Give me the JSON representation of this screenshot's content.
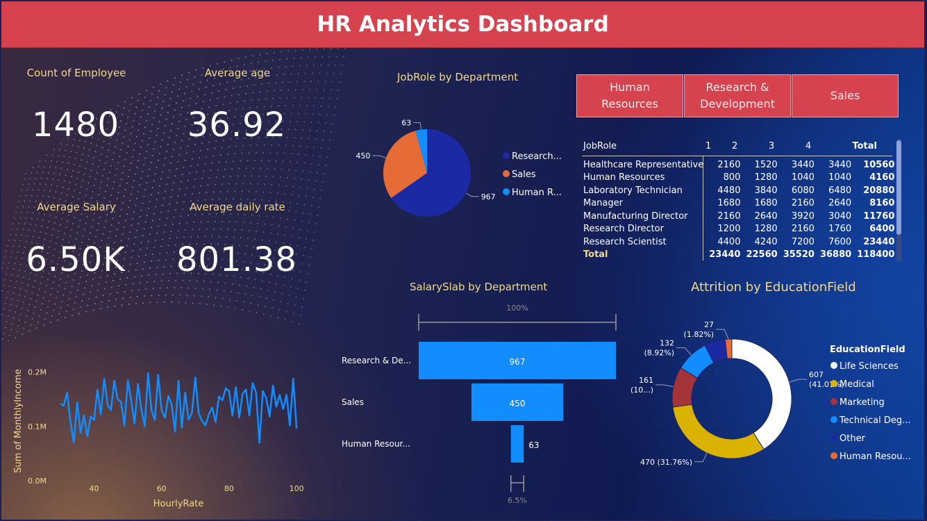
{
  "header": {
    "title": "HR Analytics Dashboard"
  },
  "kpis": [
    {
      "label": "Count of Employee",
      "value": "1480"
    },
    {
      "label": "Average age",
      "value": "36.92"
    },
    {
      "label": "Average Salary",
      "value": "6.50K"
    },
    {
      "label": "Average daily rate",
      "value": "801.38"
    }
  ],
  "jobrole_pie": {
    "title": "JobRole by Department",
    "slices": [
      {
        "label": "Research...",
        "value": 967,
        "color": "#1b2aa3"
      },
      {
        "label": "Sales",
        "value": 450,
        "color": "#e66c37"
      },
      {
        "label": "Human R...",
        "value": 63,
        "color": "#118dff"
      }
    ]
  },
  "slicers": [
    {
      "line1": "Human",
      "line2": "Resources"
    },
    {
      "line1": "Research &",
      "line2": "Development"
    },
    {
      "line1": "Sales",
      "line2": ""
    }
  ],
  "matrix": {
    "headers": [
      "JobRole",
      "1",
      "2",
      "3",
      "4",
      "Total"
    ],
    "rows": [
      [
        "Healthcare Representative",
        "2160",
        "1520",
        "3440",
        "3440",
        "10560"
      ],
      [
        "Human Resources",
        "800",
        "1280",
        "1040",
        "1040",
        "4160"
      ],
      [
        "Laboratory Technician",
        "4480",
        "3840",
        "6080",
        "6480",
        "20880"
      ],
      [
        "Manager",
        "1680",
        "1680",
        "2160",
        "2640",
        "8160"
      ],
      [
        "Manufacturing Director",
        "2160",
        "2640",
        "3920",
        "3040",
        "11760"
      ],
      [
        "Research Director",
        "1200",
        "1280",
        "2160",
        "1760",
        "6400"
      ],
      [
        "Research Scientist",
        "4400",
        "4240",
        "7200",
        "7600",
        "23440"
      ]
    ],
    "total": [
      "Total",
      "23440",
      "22560",
      "35520",
      "36880",
      "118400"
    ]
  },
  "funnel": {
    "title": "SalarySlab by Department",
    "top_pct": "100%",
    "bottom_pct": "6.5%",
    "color": "#118dff",
    "stages": [
      {
        "label": "Research & De...",
        "value": 967
      },
      {
        "label": "Sales",
        "value": 450
      },
      {
        "label": "Human Resour...",
        "value": 63
      }
    ]
  },
  "donut": {
    "title": "Attrition by EducationField",
    "legend_title": "EducationField",
    "slices": [
      {
        "label": "Life Sciences",
        "value": 607,
        "data_label": "607",
        "pct_label": "(41.01%)",
        "color": "#ffffff"
      },
      {
        "label": "Medical",
        "value": 470,
        "data_label": "470 (31.76%)",
        "pct_label": "",
        "color": "#d9b300"
      },
      {
        "label": "Marketing",
        "value": 161,
        "data_label": "161",
        "pct_label": "(10...)",
        "color": "#a4343a"
      },
      {
        "label": "Technical Deg...",
        "value": 132,
        "data_label": "132",
        "pct_label": "(8.92%)",
        "color": "#118dff"
      },
      {
        "label": "Other",
        "value": 83,
        "data_label": "",
        "pct_label": "",
        "color": "#1b2aa3"
      },
      {
        "label": "Human Resou...",
        "value": 27,
        "data_label": "27",
        "pct_label": "(1.82%)",
        "color": "#e66c37"
      }
    ]
  },
  "chart_data": {
    "type": "line",
    "title": "",
    "xlabel": "HourlyRate",
    "ylabel": "Sum of MonthlyIncome",
    "xlim": [
      29,
      101
    ],
    "ylim": [
      0,
      220000
    ],
    "x_ticks": [
      40,
      60,
      80,
      100
    ],
    "y_ticks": [
      "0.0M",
      "0.1M",
      "0.2M"
    ],
    "y_tick_values": [
      0,
      100000,
      200000
    ],
    "color": "#118dff",
    "series": [
      {
        "x": [
          30,
          31,
          32,
          33,
          34,
          35,
          36,
          37,
          38,
          39,
          40,
          41,
          42,
          43,
          44,
          45,
          46,
          47,
          48,
          49,
          50,
          51,
          52,
          53,
          54,
          55,
          56,
          57,
          58,
          59,
          60,
          61,
          62,
          63,
          64,
          65,
          66,
          67,
          68,
          69,
          70,
          71,
          72,
          73,
          74,
          75,
          76,
          77,
          78,
          79,
          80,
          81,
          82,
          83,
          84,
          85,
          86,
          87,
          88,
          89,
          90,
          91,
          92,
          93,
          94,
          95,
          96,
          97,
          98,
          99,
          100
        ],
        "y": [
          142000,
          138000,
          162000,
          110000,
          70000,
          144000,
          88000,
          120000,
          82000,
          118000,
          112000,
          168000,
          122000,
          188000,
          140000,
          130000,
          184000,
          150000,
          145000,
          102000,
          185000,
          148000,
          105000,
          178000,
          132000,
          100000,
          198000,
          130000,
          112000,
          195000,
          130000,
          116000,
          156000,
          140000,
          90000,
          184000,
          98000,
          162000,
          112000,
          125000,
          190000,
          124000,
          110000,
          102000,
          122000,
          135000,
          108000,
          155000,
          148000,
          170000,
          165000,
          120000,
          172000,
          116000,
          160000,
          168000,
          120000,
          180000,
          162000,
          70000,
          165000,
          152000,
          118000,
          175000,
          136000,
          158000,
          132000,
          158000,
          102000,
          188000,
          96000
        ]
      }
    ]
  }
}
